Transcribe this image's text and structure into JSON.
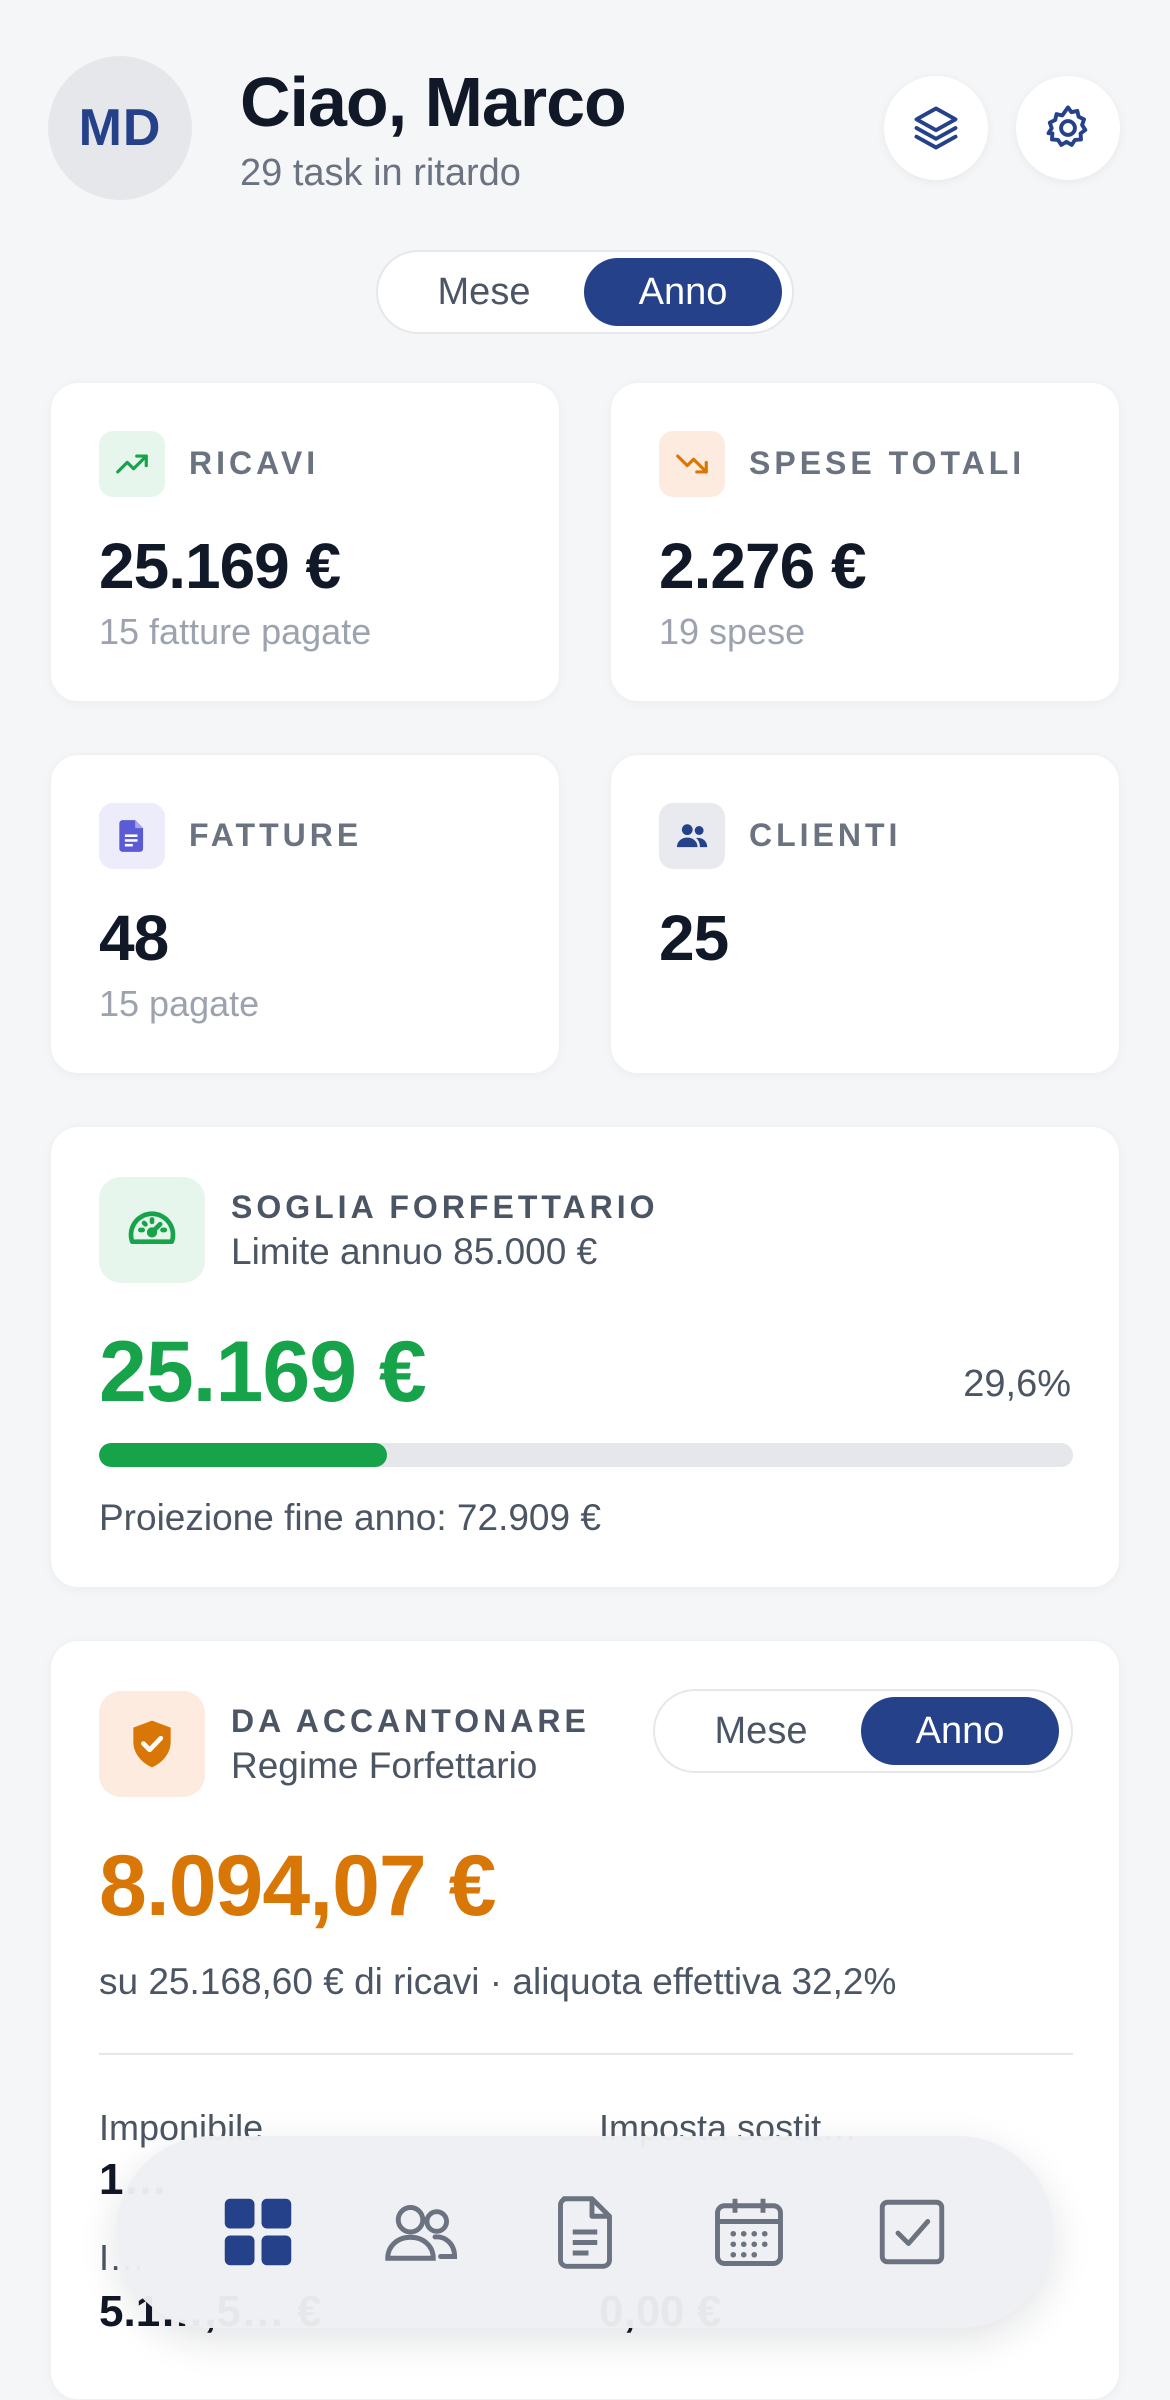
{
  "header": {
    "avatar_initials": "MD",
    "greeting": "Ciao, Marco",
    "subtitle": "29 task in ritardo",
    "layers_button_icon": "layers-icon",
    "settings_button_icon": "gear-icon"
  },
  "period_toggle": {
    "options": [
      "Mese",
      "Anno"
    ],
    "selected": "Anno"
  },
  "stats": {
    "ricavi": {
      "label": "RICAVI",
      "value": "25.169 €",
      "sub": "15 fatture pagate",
      "icon": "trending-up-icon"
    },
    "spese": {
      "label": "SPESE TOTALI",
      "value": "2.276 €",
      "sub": "19 spese",
      "icon": "trending-down-icon"
    },
    "fatture": {
      "label": "FATTURE",
      "value": "48",
      "sub": "15 pagate",
      "icon": "document-icon"
    },
    "clienti": {
      "label": "CLIENTI",
      "value": "25",
      "icon": "users-icon"
    }
  },
  "soglia": {
    "label": "SOGLIA FORFETTARIO",
    "sub": "Limite annuo 85.000 €",
    "value": "25.169 €",
    "percent_label": "29,6%",
    "progress": 0.296,
    "projection": "Proiezione fine anno: 72.909 €",
    "icon": "speedometer-icon"
  },
  "accantonare": {
    "label": "DA ACCANTONARE",
    "sub": "Regime Forfettario",
    "toggle_options": [
      "Mese",
      "Anno"
    ],
    "toggle_selected": "Anno",
    "value": "8.094,07 €",
    "detail": "su 25.168,60 € di ricavi · aliquota effettiva 32,2%",
    "icon": "shield-check-icon",
    "rows": [
      {
        "label": "Imponibile",
        "value": "1…"
      },
      {
        "label": "Imposta sostit…",
        "value": ""
      },
      {
        "label": "I…",
        "value": "5.1…,5… €"
      },
      {
        "label": "",
        "value": "0,00 €"
      }
    ]
  },
  "bottom_nav": {
    "items": [
      {
        "name": "dashboard",
        "icon": "grid-icon",
        "active": true
      },
      {
        "name": "clients",
        "icon": "users-icon",
        "active": false
      },
      {
        "name": "documents",
        "icon": "document-icon",
        "active": false
      },
      {
        "name": "calendar",
        "icon": "calendar-icon",
        "active": false
      },
      {
        "name": "tasks",
        "icon": "checkbox-icon",
        "active": false
      }
    ]
  },
  "colors": {
    "brand": "#24418a",
    "green": "#16a34a",
    "orange": "#d97706"
  }
}
